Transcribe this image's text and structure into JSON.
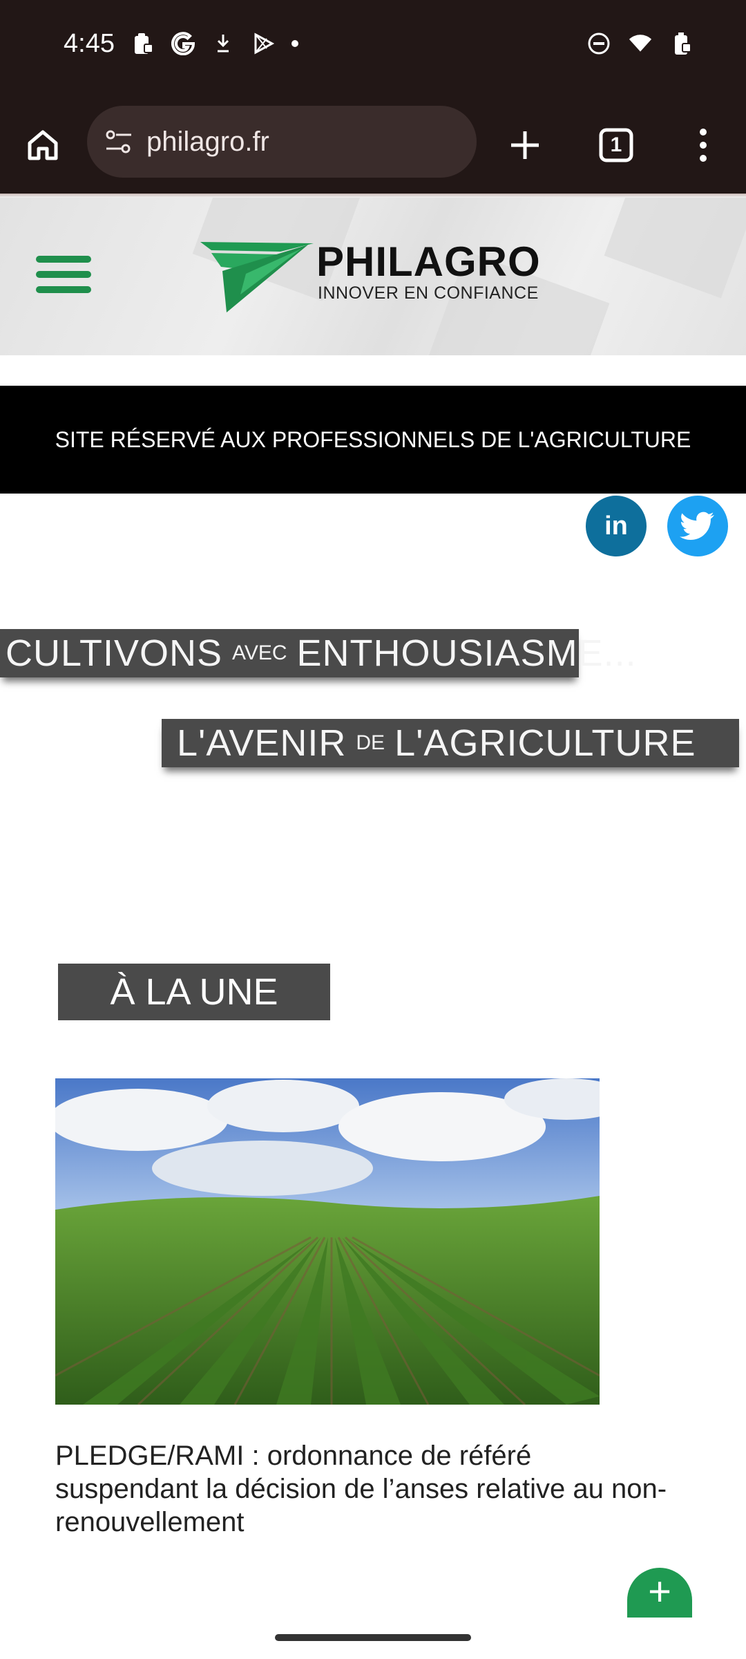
{
  "status_bar": {
    "time": "4:45",
    "left_icons": [
      "clipboard-lock-icon",
      "google-icon",
      "download-icon",
      "play-store-icon",
      "dot-icon"
    ],
    "right_icons": [
      "do-not-disturb-icon",
      "wifi-icon",
      "battery-icon"
    ]
  },
  "browser": {
    "url": "philagro.fr",
    "tab_count": "1",
    "buttons": [
      "home-icon",
      "site-settings-icon",
      "new-tab-icon",
      "tabs-icon",
      "more-icon"
    ]
  },
  "site": {
    "logo_title": "PHILAGRO",
    "logo_subtitle": "INNOVER EN CONFIANCE",
    "notice": "SITE RÉSERVÉ AUX PROFESSIONNELS DE L'AGRICULTURE",
    "social": {
      "linkedin_label": "in"
    },
    "banner1": {
      "part1": "CULTIVONS",
      "small": "AVEC",
      "part2": "ENTHOUSIASME..."
    },
    "banner2": {
      "part1": "L'AVENIR",
      "small": "DE",
      "part2": "L'AGRICULTURE"
    },
    "section_title": "À LA UNE",
    "article_title": "PLEDGE/RAMI : ordonnance de référé suspendant la décision de l’anses relative au non-renouvellement",
    "fab_label": "+",
    "colors": {
      "brand_green": "#1f9a52",
      "banner_gray": "#4a4a4a",
      "chrome": "#221716"
    }
  }
}
